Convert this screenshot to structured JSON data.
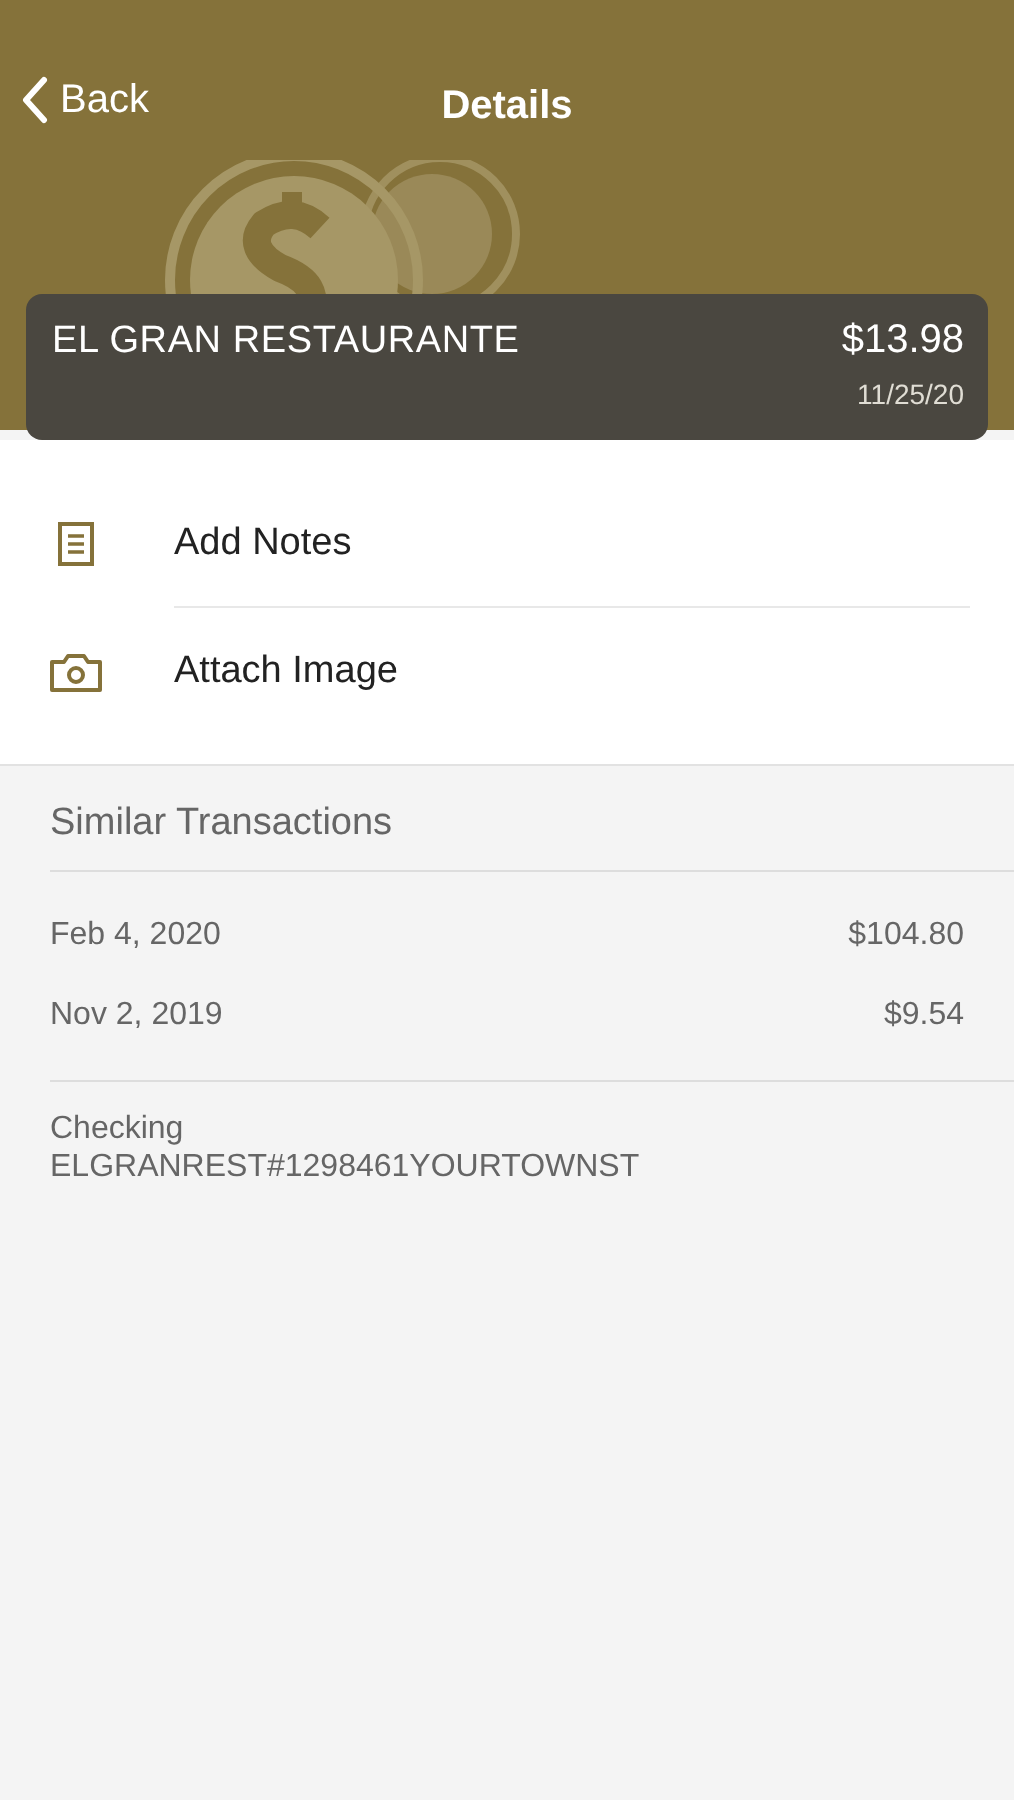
{
  "nav": {
    "back": "Back",
    "title": "Details"
  },
  "transaction": {
    "merchant": "EL GRAN RESTAURANTE",
    "amount": "$13.98",
    "date": "11/25/20"
  },
  "actions": [
    {
      "kind": "notes",
      "label": "Add Notes"
    },
    {
      "kind": "camera",
      "label": "Attach Image"
    }
  ],
  "similar": {
    "title": "Similar Transactions",
    "rows": [
      {
        "date": "Feb 4, 2020",
        "amount": "$104.80"
      },
      {
        "date": "Nov 2, 2019",
        "amount": "$9.54"
      }
    ]
  },
  "account": {
    "name": "Checking",
    "description": "ELGRANREST#1298461YOURTOWNST"
  }
}
